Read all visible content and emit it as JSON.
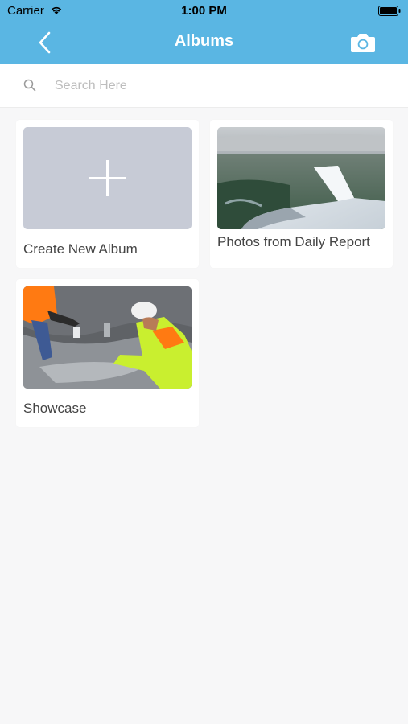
{
  "status": {
    "carrier": "Carrier",
    "time": "1:00 PM"
  },
  "nav": {
    "title": "Albums",
    "back_icon": "chevron-left-icon",
    "camera_icon": "camera-icon"
  },
  "search": {
    "placeholder": "Search Here",
    "value": ""
  },
  "albums": [
    {
      "label": "Create New Album"
    },
    {
      "label": "Photos from Daily Report"
    },
    {
      "label": "Showcase"
    }
  ],
  "colors": {
    "header": "#5ab6e3",
    "background": "#f7f7f8",
    "new_album_tile": "#c7cbd6"
  }
}
